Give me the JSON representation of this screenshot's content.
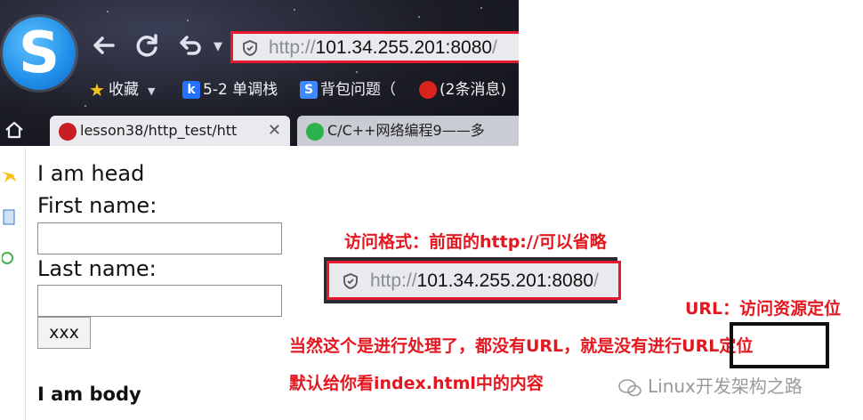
{
  "browser": {
    "address_bar": {
      "protocol": "http://",
      "host": "101.34.255.201:8080",
      "trailing": "/"
    },
    "nav_icons": [
      "back-icon",
      "refresh-icon",
      "undo-icon"
    ],
    "bookmarks": [
      {
        "label": "收藏",
        "icon": "star-icon"
      },
      {
        "label": "5-2 单调栈",
        "icon": "bookmark-k-icon"
      },
      {
        "label": "背包问题（",
        "icon": "bookmark-s-icon"
      },
      {
        "label": "(2条消息)",
        "icon": "bookmark-csdn-icon"
      }
    ],
    "tabs": [
      {
        "label": "lesson38/http_test/htt",
        "close": "✕",
        "icon": "gitee-icon"
      },
      {
        "label": "C/C++网络编程9——多",
        "icon": "c-icon"
      }
    ],
    "colors": {
      "highlight": "#e6192f"
    }
  },
  "page": {
    "head_text": "I am head",
    "first_name_label": "First name:",
    "first_name_value": "",
    "last_name_label": "Last name:",
    "last_name_value": "",
    "button_label": "xxx",
    "body_text": "I am body"
  },
  "annotations": {
    "format_note": "访问格式：前面的http://可以省略",
    "zoomed_address": {
      "protocol": "http://",
      "host": "101.34.255.201:8080",
      "trailing": "/"
    },
    "url_note": "URL：访问资源定位",
    "processing_note": "当然这个是进行处理了，都没有URL，就是没有进行URL定位",
    "default_note": "默认给你看index.html中的内容",
    "colors": {
      "annotation": "#e3171f"
    }
  },
  "watermark": {
    "text": "Linux开发架构之路",
    "icon": "wechat-icon"
  }
}
